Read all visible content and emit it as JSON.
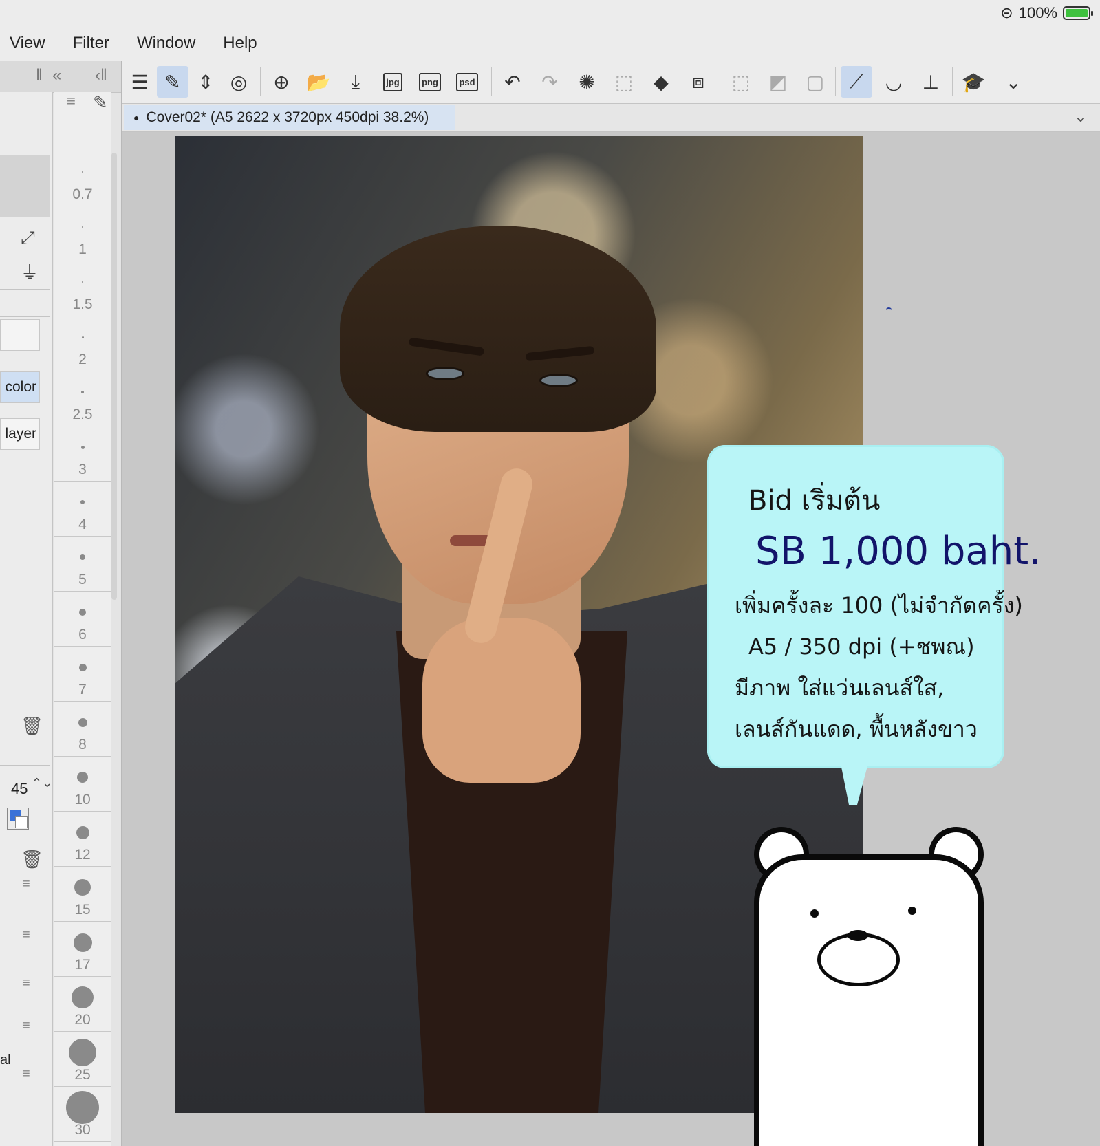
{
  "status": {
    "battery_percent": "100%",
    "battery_level": 1.0
  },
  "menu": {
    "items": [
      "View",
      "Filter",
      "Window",
      "Help"
    ]
  },
  "left_panel": {
    "layer_labels": [
      "color",
      "layer"
    ],
    "opacity_value": "45",
    "bottom_partial_label": "al"
  },
  "brush_sizes": [
    "0.7",
    "1",
    "1.5",
    "2",
    "2.5",
    "3",
    "4",
    "5",
    "6",
    "7",
    "8",
    "10",
    "12",
    "15",
    "17",
    "20",
    "25",
    "30"
  ],
  "toolbar": {
    "export_jpg": "jpg",
    "export_png": "png",
    "export_psd": "psd"
  },
  "document": {
    "tab_title": "Cover02* (A5 2622 x 3720px 450dpi 38.2%)"
  },
  "speech_bubble": {
    "line1": "Bid  เริ่มต้น",
    "line2": "SB 1,000 baht.",
    "line3": "เพิ่มครั้งละ 100 (ไม่จำกัดครั้ง)",
    "line4": "A5 / 350 dpi (+ชพณ)",
    "line5": "มีภาพ ใส่แว่นเลนส์ใส,",
    "line6": "เลนส์กันแดด, พื้นหลังขาว"
  },
  "colors": {
    "accent_active": "#c8d8ee",
    "bubble": "#b9f5f7",
    "main_color": "#3a72d8"
  }
}
